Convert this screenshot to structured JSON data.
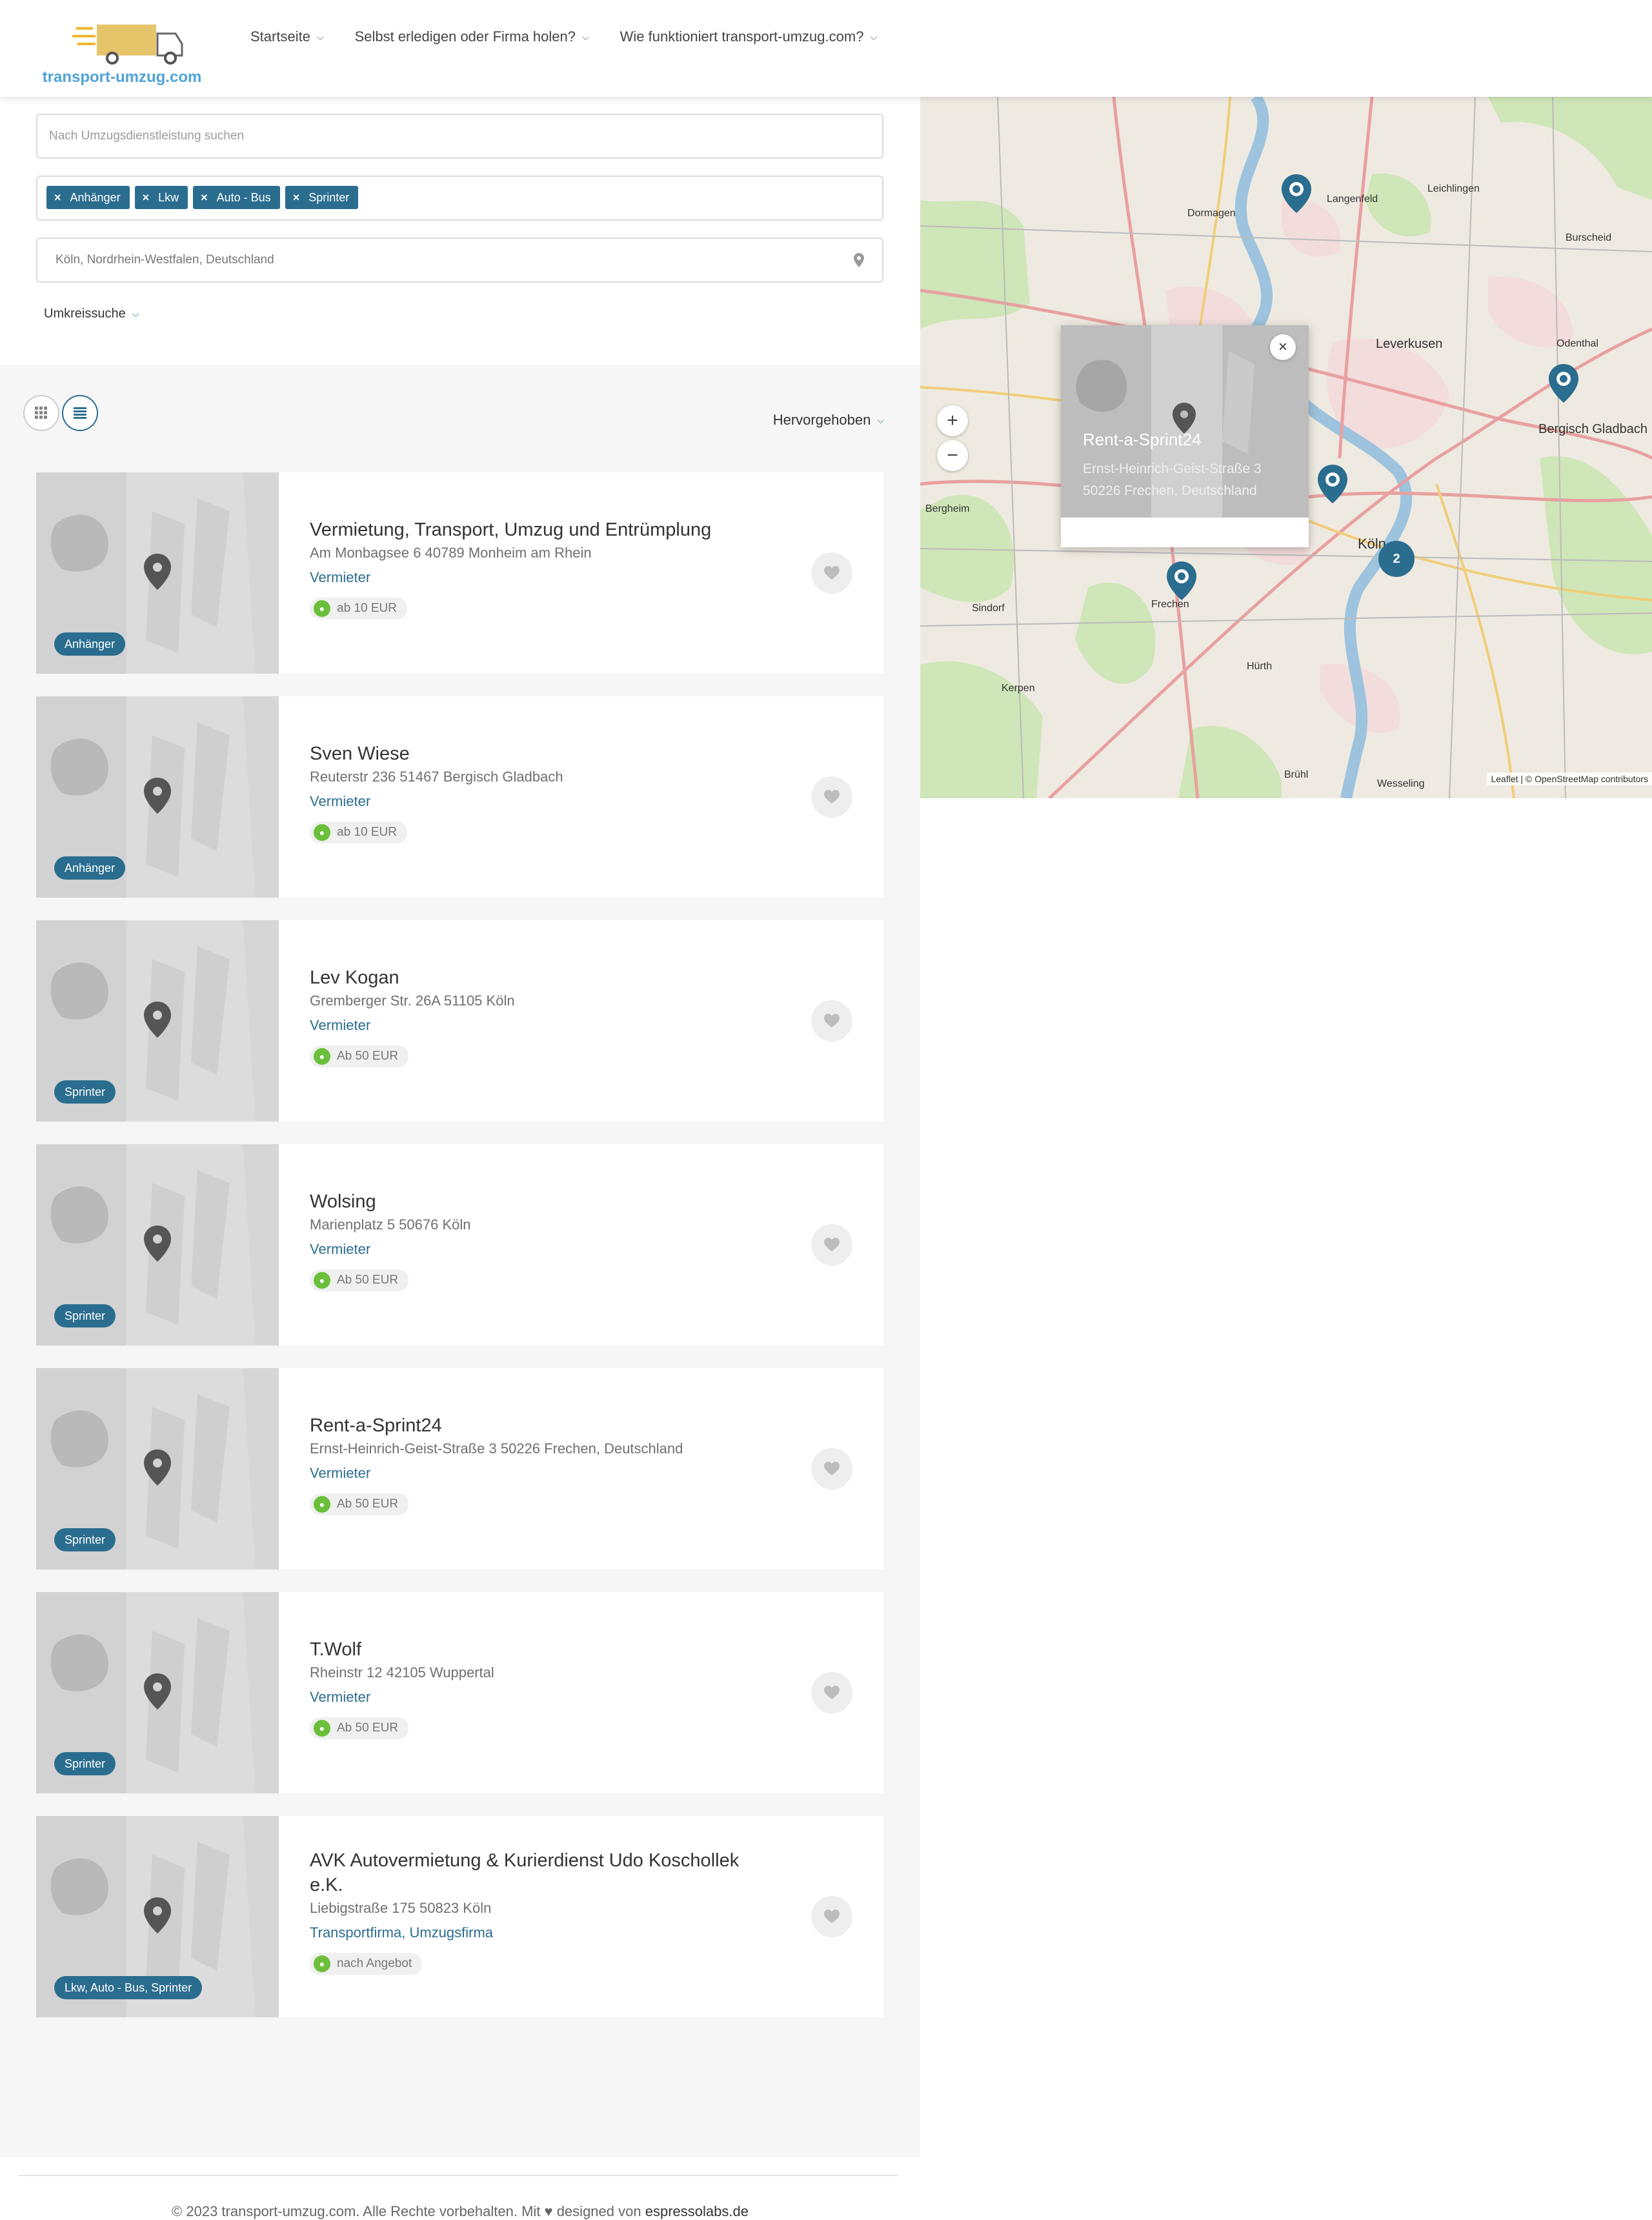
{
  "header": {
    "logo_text": "transport-umzug.com",
    "nav": [
      {
        "label": "Startseite"
      },
      {
        "label": "Selbst erledigen oder Firma holen?"
      },
      {
        "label": "Wie funktioniert transport-umzug.com?"
      }
    ]
  },
  "search": {
    "keyword_placeholder": "Nach Umzugsdienstleistung suchen",
    "tags": [
      "Anhänger",
      "Lkw",
      "Auto - Bus",
      "Sprinter"
    ],
    "location_value": "Köln, Nordrhein-Westfalen, Deutschland",
    "radius_label": "Umkreissuche"
  },
  "sort_label": "Hervorgehoben",
  "listings": [
    {
      "title": "Vermietung, Transport, Umzug und Entrümplung",
      "address": "Am Monbagsee 6 40789 Monheim am Rhein",
      "category": "Vermieter",
      "price": "ab 10 EUR",
      "badge": "Anhänger"
    },
    {
      "title": "Sven Wiese",
      "address": "Reuterstr 236 51467 Bergisch Gladbach",
      "category": "Vermieter",
      "price": "ab 10 EUR",
      "badge": "Anhänger"
    },
    {
      "title": "Lev Kogan",
      "address": "Gremberger Str. 26A 51105 Köln",
      "category": "Vermieter",
      "price": "Ab 50 EUR",
      "badge": "Sprinter"
    },
    {
      "title": "Wolsing",
      "address": "Marienplatz 5 50676 Köln",
      "category": "Vermieter",
      "price": "Ab 50 EUR",
      "badge": "Sprinter"
    },
    {
      "title": "Rent-a-Sprint24",
      "address": "Ernst-Heinrich-Geist-Straße 3 50226 Frechen, Deutschland",
      "category": "Vermieter",
      "price": "Ab 50 EUR",
      "badge": "Sprinter"
    },
    {
      "title": "T.Wolf",
      "address": "Rheinstr 12 42105 Wuppertal",
      "category": "Vermieter",
      "price": "Ab 50 EUR",
      "badge": "Sprinter"
    },
    {
      "title": "AVK Autovermietung & Kurierdienst Udo Koschollek e.K.",
      "address": "Liebigstraße 175 50823 Köln",
      "category": "Transportfirma, Umzugsfirma",
      "price": "nach Angebot",
      "badge": "Lkw, Auto - Bus, Sprinter"
    }
  ],
  "map": {
    "popup_title": "Rent-a-Sprint24",
    "popup_address_line1": "Ernst-Heinrich-Geist-Straße 3",
    "popup_address_line2": "50226 Frechen, Deutschland",
    "cluster_count": "2",
    "attribution": "Leaflet | © OpenStreetMap contributors",
    "labels": [
      "Leichlingen",
      "Langenfeld",
      "Dormagen",
      "Burscheid",
      "Leverkusen",
      "Odenthal",
      "Bergisch Gladbach",
      "Bergheim",
      "Köln",
      "Frechen",
      "Sindorf",
      "Hürth",
      "Kerpen",
      "Brühl",
      "Wesseling"
    ]
  },
  "footer": {
    "text": "© 2023 transport-umzug.com. Alle Rechte vorbehalten. Mit ♥ designed von",
    "link": "espressolabs.de"
  }
}
